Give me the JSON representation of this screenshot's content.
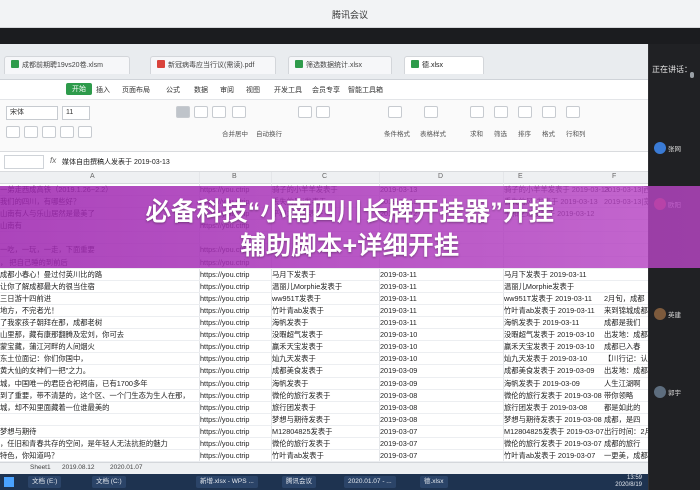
{
  "meeting": {
    "title": "腾讯会议",
    "status": "正在讲话：",
    "participants": [
      "张网",
      "欧阳",
      "英建",
      "郭宇"
    ]
  },
  "tabs": [
    {
      "label": "成都前期聘19vs20卷.xlsm"
    },
    {
      "label": "新冠病毒应当行议(需读).pdf"
    },
    {
      "label": "筛选数据统计.xlsx"
    },
    {
      "label": "德.xlsx"
    }
  ],
  "ribbon": {
    "menu": [
      "开始",
      "插入",
      "页面布局",
      "公式",
      "数据",
      "审阅",
      "视图",
      "开发工具",
      "会员专享",
      "智能工具箱"
    ],
    "font_name": "宋体",
    "font_size": "11",
    "tool_labels": [
      "合并居中",
      "自动换行",
      "条件格式",
      "表格样式",
      "求和",
      "筛选",
      "排序",
      "格式",
      "行和列"
    ]
  },
  "formula_bar": {
    "content": "媒体自由撰稿人发表于 2019-03-13"
  },
  "columns": [
    "A",
    "B",
    "C",
    "D",
    "E",
    "F"
  ],
  "rows": [
    {
      "a": "一弟走西成高铁（2019.1.26~2.2）",
      "b": "https://you.ctrip",
      "c": "骑子的小羊羊发表于",
      "d": "2019-03-13",
      "e": "骑子的小羊羊发表于 2019-03-13"
    },
    {
      "a": "我们的四川，有哪些好？",
      "b": "https://you.ctrip",
      "c": "丢失的风jj发表于",
      "d": "2019-03-13",
      "e": "丢失的风jj发表于 2019-03-13"
    },
    {
      "a": "山南有人与乐山居然是最美了",
      "b": "https://you.ctrip",
      "c": "平和之道发表于",
      "d": "2019-03-12",
      "e": "平和之道发表于 2019-03-12"
    },
    {
      "a": "山南有",
      "b": "https://you.ctrip",
      "c": "",
      "d": "",
      "e": ""
    },
    {
      "a": "",
      "b": "",
      "c": "",
      "d": "",
      "e": ""
    },
    {
      "a": "一吃，一玩，一走，下面重要",
      "b": "https://you.ctrip",
      "c": "",
      "d": "",
      "e": ""
    },
    {
      "a": "， 把自己睡的到前后",
      "b": "https://you.ctrip",
      "c": "",
      "d": "",
      "e": ""
    },
    {
      "a": "成都小春心！曼过付英川比的路",
      "b": "https://you.ctrip",
      "c": "马月下发表于",
      "d": "2019-03-11",
      "e": "马月下发表于 2019-03-11"
    },
    {
      "a": "让你了解成都最大的很当住宿",
      "b": "https://you.ctrip",
      "c": "温丽儿Morphie发表于",
      "d": "2019-03-11",
      "e": "温丽儿Morphie发表于"
    },
    {
      "a": "三日游十四前进",
      "b": "https://you.ctrip",
      "c": "ww951T发表于",
      "d": "2019-03-11",
      "e": "ww951T发表于 2019-03-11"
    },
    {
      "a": "地方，不完者光！",
      "b": "https://you.ctrip",
      "c": "竹叶青ab发表于",
      "d": "2019-03-11",
      "e": "竹叶青ab发表于 2019-03-11"
    },
    {
      "a": "了我家孩子朝拜在那，成都老树",
      "b": "https://you.ctrip",
      "c": "海帆发表于",
      "d": "2019-03-11",
      "e": "海帆发表于 2019-03-11"
    },
    {
      "a": "山里那，藏有康那翻腾及宏刘，你可去",
      "b": "https://you.ctrip",
      "c": "没暇超气发表于",
      "d": "2019-03-10",
      "e": "没暇超气发表于 2019-03-10"
    },
    {
      "a": "蒙宝藏，蒲江河畔的人间烟火",
      "b": "https://you.ctrip",
      "c": "赢禾天宝发表于",
      "d": "2019-03-10",
      "e": "赢禾天宝发表于 2019-03-10"
    },
    {
      "a": "东土位面记：你们你国中，",
      "b": "https://you.ctrip",
      "c": "灿九天发表于",
      "d": "2019-03-10",
      "e": "灿九天发表于 2019-03-10"
    },
    {
      "a": "黄大仙的女神们一把”之力。",
      "b": "https://you.ctrip",
      "c": "成都美食发表于",
      "d": "2019-03-09",
      "e": "成都美食发表于 2019-03-09"
    },
    {
      "a": "城，中国唯一的君臣合祀祠庙，已有1700多年",
      "b": "https://you.ctrip",
      "c": "海帆发表于",
      "d": "2019-03-09",
      "e": "海帆发表于 2019-03-09"
    },
    {
      "a": "到了重要，带不清楚的，这个区、一个门生态为生人在那，",
      "b": "https://you.ctrip",
      "c": "微伦的旅行发表于",
      "d": "2019-03-08",
      "e": "微伦的旅行发表于 2019-03-08"
    },
    {
      "a": "城，却不知里面藏着一位谁最美的",
      "b": "https://you.ctrip",
      "c": "旅行团发表于",
      "d": "2019-03-08",
      "e": "旅行团发表于 2019-03-08"
    },
    {
      "a": "",
      "b": "https://you.ctrip",
      "c": "梦想与期待发表于",
      "d": "2019-03-08",
      "e": "梦想与期待发表于 2019-03-08"
    },
    {
      "a": "梦想与期待",
      "b": "https://you.ctrip",
      "c": "M12804825发表于",
      "d": "2019-03-07",
      "e": "M12804825发表于 2019-03-07"
    },
    {
      "a": "，任旧和青春共存的空间，是年轻人无法抗拒的魅力",
      "b": "https://you.ctrip",
      "c": "微伦的旅行发表于",
      "d": "2019-03-07",
      "e": "微伦的旅行发表于 2019-03-07"
    },
    {
      "a": "特色，你知道吗？",
      "b": "https://you.ctrip",
      "c": "竹叶青ab发表于",
      "d": "2019-03-07",
      "e": "竹叶青ab发表于 2019-03-07"
    },
    {
      "a": "了我大都城部开展到了，原来后面小的中国都能找到",
      "b": "https://you.ctrip",
      "c": "微伦的旅行发表于",
      "d": "2019-03-06",
      "e": "微伦的旅行发表于 2019-03-06"
    }
  ],
  "col_f_snippets": [
    "2019-03-13|西成高铁1",
    "2019-03-13|宽窄巷子",
    "",
    "",
    "",
    "",
    "",
    "",
    "",
    "2月旬，成都",
    "来到锦城成都",
    "成都是我们",
    "出发地：成都",
    "成都已入春",
    "【川行记：认识",
    "出发地：成都",
    "人生江湖啊",
    "带你领略",
    "都是如此的",
    "成都，是四",
    "出行时间：2月",
    "成都的旅行",
    "一更美，成都",
    "成都，三家"
  ],
  "sheet_tabs": [
    "Sheet1",
    "2019.08.12",
    "2020.01.07"
  ],
  "taskbar": {
    "items": [
      "文档 (E:)",
      "文档 (C:)",
      "新增.xlsx - WPS ...",
      "腾讯会议",
      "2020.01.07 - ...",
      "德.xlsx"
    ],
    "time": "13:59",
    "date": "2020/8/19"
  },
  "overlay": {
    "line1": "必备科技“小南四川长牌开挂器”开挂",
    "line2": "辅助脚本+详细开挂",
    "color": "#9e26b0"
  }
}
